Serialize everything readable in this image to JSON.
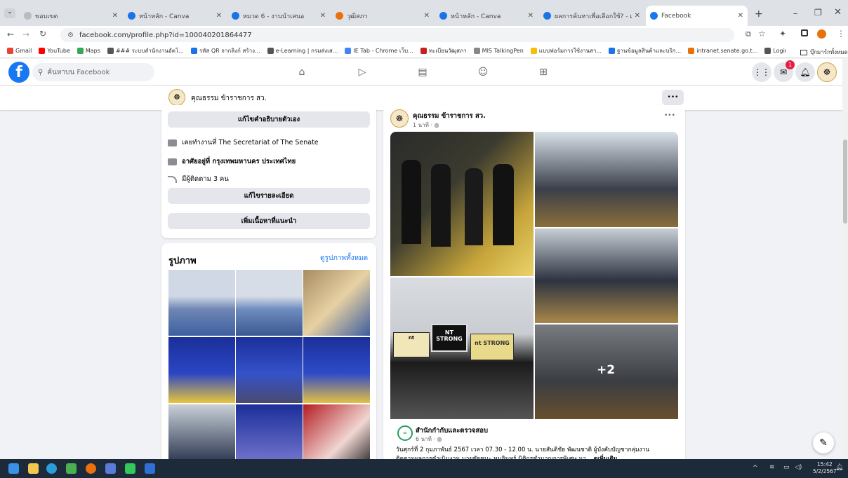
{
  "browser": {
    "tabs": [
      {
        "title": "ขอบเขต",
        "color": "#bbbbbb"
      },
      {
        "title": "หน้าหลัก - Canva",
        "color": "#1a73e8"
      },
      {
        "title": "หมวด 6 - งานนำเสนอ",
        "color": "#1a73e8"
      },
      {
        "title": "วุฒิสภา",
        "color": "#e8710a"
      },
      {
        "title": "หน้าหลัก - Canva",
        "color": "#1a73e8"
      },
      {
        "title": "ผลการค้นหาเพื่อเลือกใช้? - เอกสาร",
        "color": "#1a73e8"
      },
      {
        "title": "Facebook",
        "color": "#1877f2"
      }
    ],
    "new_tab": "+",
    "url": "facebook.com/profile.php?id=100040201864477",
    "bookmarks": [
      "Gmail",
      "YouTube",
      "Maps",
      "### ระบบสำนักงานอัตโ...",
      "รหัส QR จากลิงก์ สร้าง...",
      "e-Learning | กรมส่งเส...",
      "IE Tab - Chrome เว็บ...",
      "ทะเบียนวัฒุสภา",
      "MIS TalkingPen",
      "แบบฟอร์มการใช้งานสา...",
      "ฐานข้อมูลสินค้าและบริก...",
      "intranet.senate.go.t...",
      "Login"
    ],
    "all_bookmarks": "บุ๊กมาร์กทั้งหมด",
    "bookmark_colors": [
      "#ea4335",
      "#ff0000",
      "#34a853",
      "#555555",
      "#1a73e8",
      "#555555",
      "#4285f4",
      "#c5221f",
      "#888888",
      "#fbbc04",
      "#1a73e8",
      "#e8710a",
      "#555555"
    ]
  },
  "fb": {
    "search_placeholder": "ค้นหาบน Facebook",
    "profile_name": "คุณธรรม ข้าราชการ สว.",
    "more": "•••",
    "notif_count": "1",
    "intro": {
      "edit_bio": "แก้ไขคำอธิบายตัวเอง",
      "work": "เคยทำงานที่ The Secretariat of The Senate",
      "lives": "อาศัยอยู่ที่ กรุงเทพมหานคร ประเทศไทย",
      "followers": "มีผู้ติดตาม 3 คน",
      "edit_details": "แก้ไขรายละเอียด",
      "add_featured": "เพิ่มเนื้อหาที่แนะนำ"
    },
    "photos": {
      "title": "รูปภาพ",
      "see_all": "ดูรูปภาพทั้งหมด"
    },
    "post": {
      "author": "คุณธรรม ข้าราชการ สว.",
      "time": "1 นาที · ",
      "more_count": "+2",
      "shared_author": "สำนักกำกับและตรวจสอบ",
      "shared_time": "6 นาที · ",
      "text1": "วันศุกร์ที่ 2 กุมภาพันธ์ 2567 เวลา 07.30 - 12.00 น. นายสันติชัย พัฒนชาติ ผู้บังคับบัญชากลุ่มงาน",
      "text2": "ติดตามผลการดำเนินงาน นายชัยชนะ หนอินทร์ นิติกรชำนาญการพิเศษ นา...",
      "see_more": "ดูเพิ่มเติม",
      "sign1": "NT STRONG",
      "sign2": "nt STRONG",
      "sign3": "nt"
    }
  },
  "taskbar": {
    "time": "15:42",
    "date": "5/2/2567"
  }
}
